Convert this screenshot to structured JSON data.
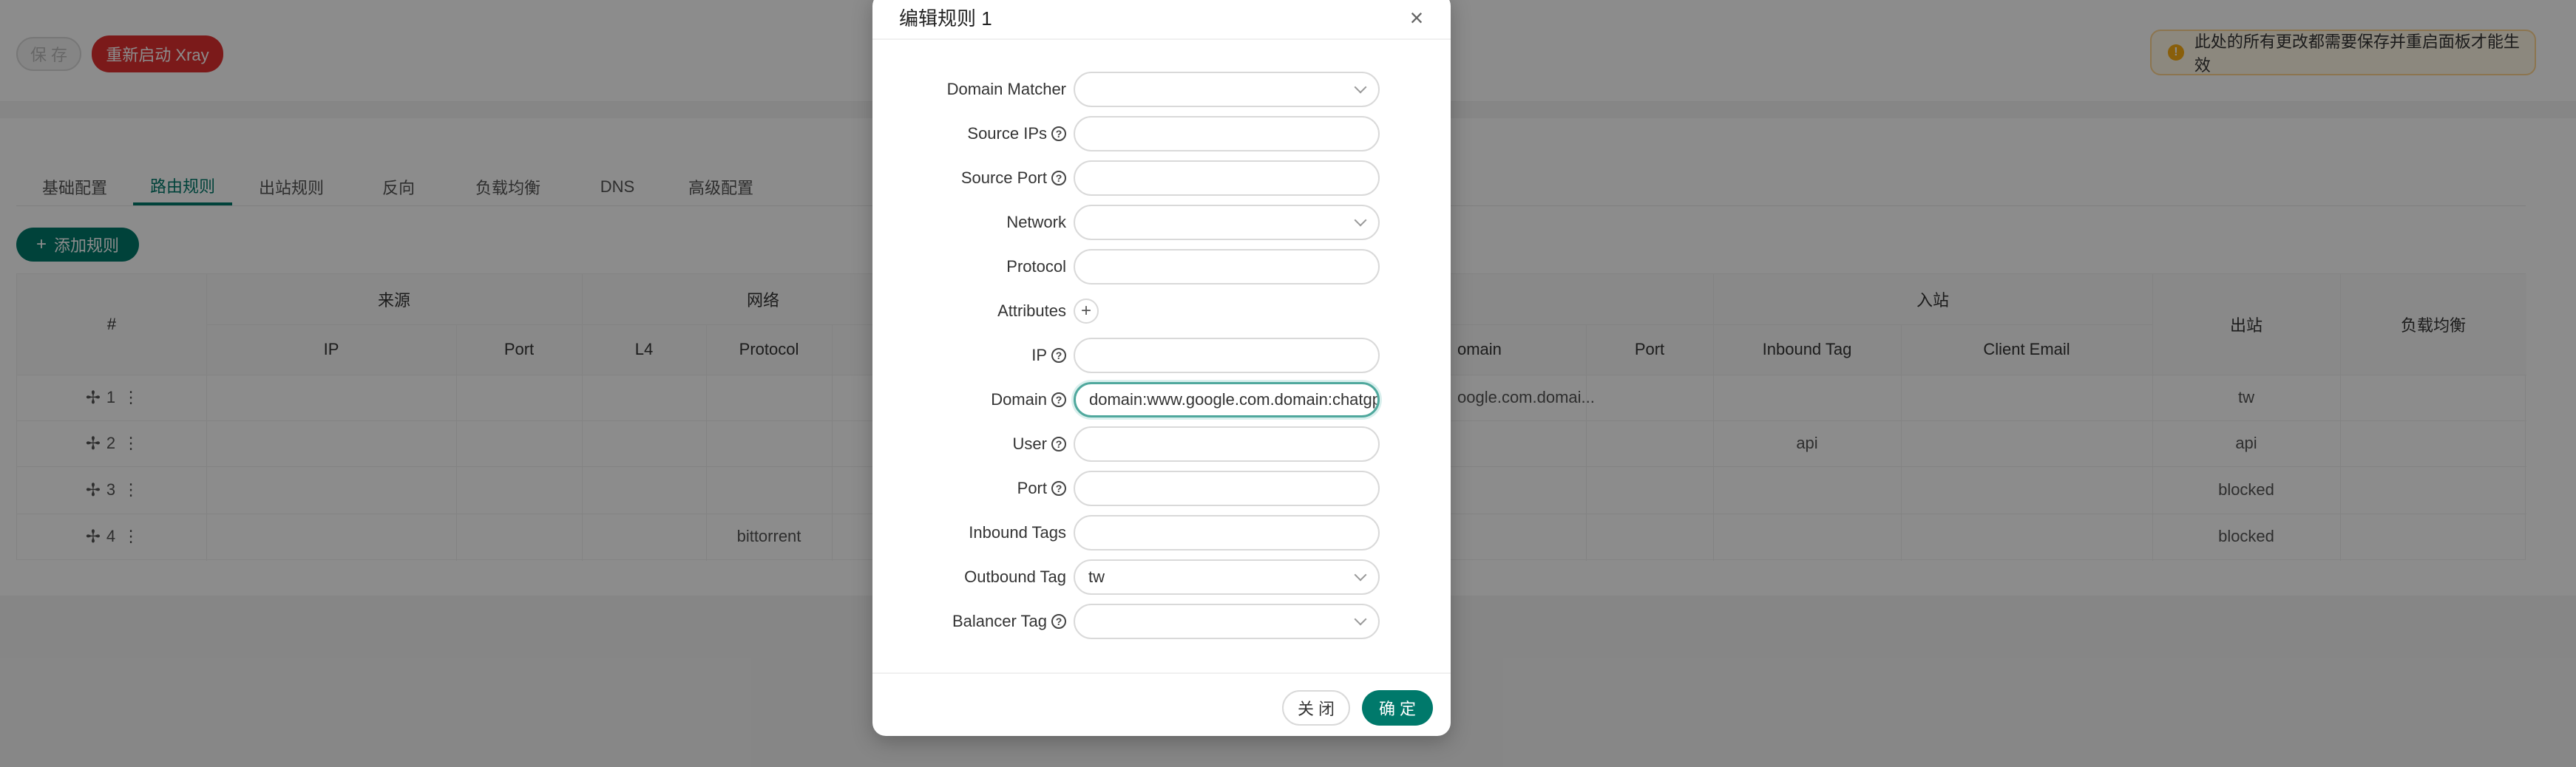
{
  "toolbar": {
    "save_label": "保 存",
    "restart_label": "重新启动 Xray",
    "notice_text": "此处的所有更改都需要保存并重启面板才能生效"
  },
  "tabs": [
    "基础配置",
    "路由规则",
    "出站规则",
    "反向",
    "负载均衡",
    "DNS",
    "高级配置"
  ],
  "active_tab": "路由规则",
  "add_rule_label": "添加规则",
  "table": {
    "group_headers": {
      "index": "#",
      "source": "来源",
      "network": "网络",
      "inbound": "入站",
      "outbound": "出站",
      "balancer": "负载均衡"
    },
    "sub_headers": {
      "ip": "IP",
      "port": "Port",
      "l4": "L4",
      "protocol": "Protocol",
      "domain": "omain",
      "dest_port": "Port",
      "inbound_tag": "Inbound Tag",
      "client_email": "Client Email"
    },
    "rows": [
      {
        "index": "1",
        "protocol": "",
        "domain": "oogle.com.domai...",
        "inbound_tag": "",
        "outbound": "tw"
      },
      {
        "index": "2",
        "protocol": "",
        "domain": "",
        "inbound_tag": "api",
        "outbound": "api"
      },
      {
        "index": "3",
        "protocol": "",
        "domain": "",
        "inbound_tag": "",
        "outbound": "blocked"
      },
      {
        "index": "4",
        "protocol": "bittorrent",
        "domain": "",
        "inbound_tag": "",
        "outbound": "blocked"
      }
    ]
  },
  "modal": {
    "title": "编辑规则 1",
    "fields": {
      "domain_matcher": {
        "label": "Domain Matcher",
        "value": ""
      },
      "source_ips": {
        "label": "Source IPs",
        "value": ""
      },
      "source_port": {
        "label": "Source Port",
        "value": ""
      },
      "network": {
        "label": "Network",
        "value": ""
      },
      "protocol": {
        "label": "Protocol",
        "value": ""
      },
      "attributes": {
        "label": "Attributes"
      },
      "ip": {
        "label": "IP",
        "value": ""
      },
      "domain": {
        "label": "Domain",
        "value": "domain:www.google.com.domain:chatgp"
      },
      "user": {
        "label": "User",
        "value": ""
      },
      "port": {
        "label": "Port",
        "value": ""
      },
      "inbound_tags": {
        "label": "Inbound Tags",
        "value": ""
      },
      "outbound_tag": {
        "label": "Outbound Tag",
        "value": "tw"
      },
      "balancer_tag": {
        "label": "Balancer Tag",
        "value": ""
      }
    },
    "close_label": "关 闭",
    "ok_label": "确 定"
  },
  "colors": {
    "primary": "#00796b",
    "danger": "#e03131",
    "warning": "#faad14"
  }
}
